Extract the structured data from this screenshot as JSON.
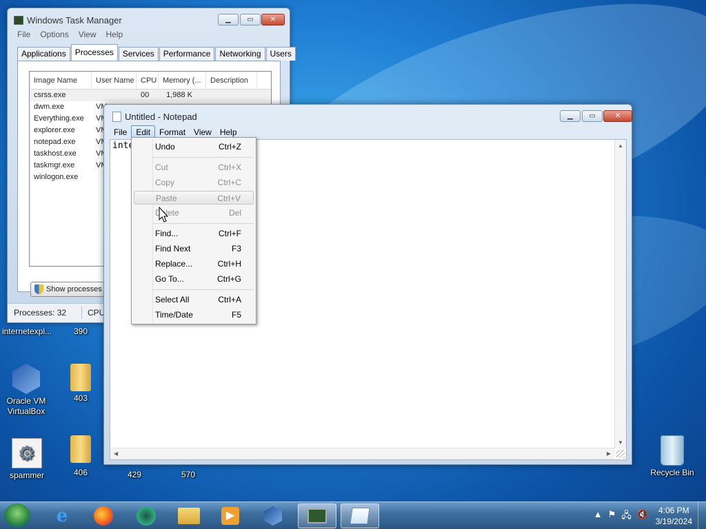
{
  "task_manager": {
    "title": "Windows Task Manager",
    "menu": [
      "File",
      "Options",
      "View",
      "Help"
    ],
    "tabs": [
      "Applications",
      "Processes",
      "Services",
      "Performance",
      "Networking",
      "Users"
    ],
    "columns": [
      "Image Name",
      "User Name",
      "CPU",
      "Memory (...",
      "Description"
    ],
    "rows": [
      {
        "name": "csrss.exe",
        "user": "",
        "cpu": "00",
        "mem": "1,988 K"
      },
      {
        "name": "dwm.exe",
        "user": "VM",
        "cpu": "",
        "mem": ""
      },
      {
        "name": "Everything.exe",
        "user": "VM",
        "cpu": "",
        "mem": ""
      },
      {
        "name": "explorer.exe",
        "user": "VM",
        "cpu": "",
        "mem": ""
      },
      {
        "name": "notepad.exe",
        "user": "VM",
        "cpu": "",
        "mem": ""
      },
      {
        "name": "taskhost.exe",
        "user": "VM",
        "cpu": "",
        "mem": ""
      },
      {
        "name": "taskmgr.exe",
        "user": "VM",
        "cpu": "",
        "mem": ""
      },
      {
        "name": "winlogon.exe",
        "user": "",
        "cpu": "",
        "mem": ""
      }
    ],
    "show_processes_label": "Show processes f",
    "status_processes": "Processes: 32",
    "status_cpu": "CPU"
  },
  "notepad": {
    "title": "Untitled - Notepad",
    "menu": [
      "File",
      "Edit",
      "Format",
      "View",
      "Help"
    ],
    "text": "inte",
    "edit_menu": [
      {
        "label": "Undo",
        "key": "Ctrl+Z",
        "disabled": false
      },
      {
        "label": "Cut",
        "key": "Ctrl+X",
        "disabled": true
      },
      {
        "label": "Copy",
        "key": "Ctrl+C",
        "disabled": true
      },
      {
        "label": "Paste",
        "key": "Ctrl+V",
        "disabled": true
      },
      {
        "label": "Delete",
        "key": "Del",
        "disabled": true
      },
      {
        "label": "Find...",
        "key": "Ctrl+F",
        "disabled": false
      },
      {
        "label": "Find Next",
        "key": "F3",
        "disabled": false
      },
      {
        "label": "Replace...",
        "key": "Ctrl+H",
        "disabled": false
      },
      {
        "label": "Go To...",
        "key": "Ctrl+G",
        "disabled": false
      },
      {
        "label": "Select All",
        "key": "Ctrl+A",
        "disabled": false
      },
      {
        "label": "Time/Date",
        "key": "F5",
        "disabled": false
      }
    ]
  },
  "desktop": {
    "icons": [
      {
        "label": "internetexpl...",
        "icon": "internet-explorer-icon"
      },
      {
        "label": "390",
        "icon": "file-icon"
      },
      {
        "label": "Oracle VM VirtualBox",
        "icon": "virtualbox-icon"
      },
      {
        "label": "403",
        "icon": "folder-icon"
      },
      {
        "label": "spammer",
        "icon": "gear-icon"
      },
      {
        "label": "406",
        "icon": "folder-icon"
      },
      {
        "label": "429",
        "icon": "file-icon"
      },
      {
        "label": "570",
        "icon": "file-icon"
      },
      {
        "label": "Recycle Bin",
        "icon": "recycle-bin-icon"
      }
    ]
  },
  "taskbar": {
    "apps": [
      "internet-explorer-icon",
      "firefox-icon",
      "media-icon",
      "file-explorer-icon",
      "media-player-icon",
      "virtualbox-icon",
      "task-manager-icon",
      "notepad-icon"
    ],
    "time": "4:06 PM",
    "date": "3/19/2024"
  }
}
